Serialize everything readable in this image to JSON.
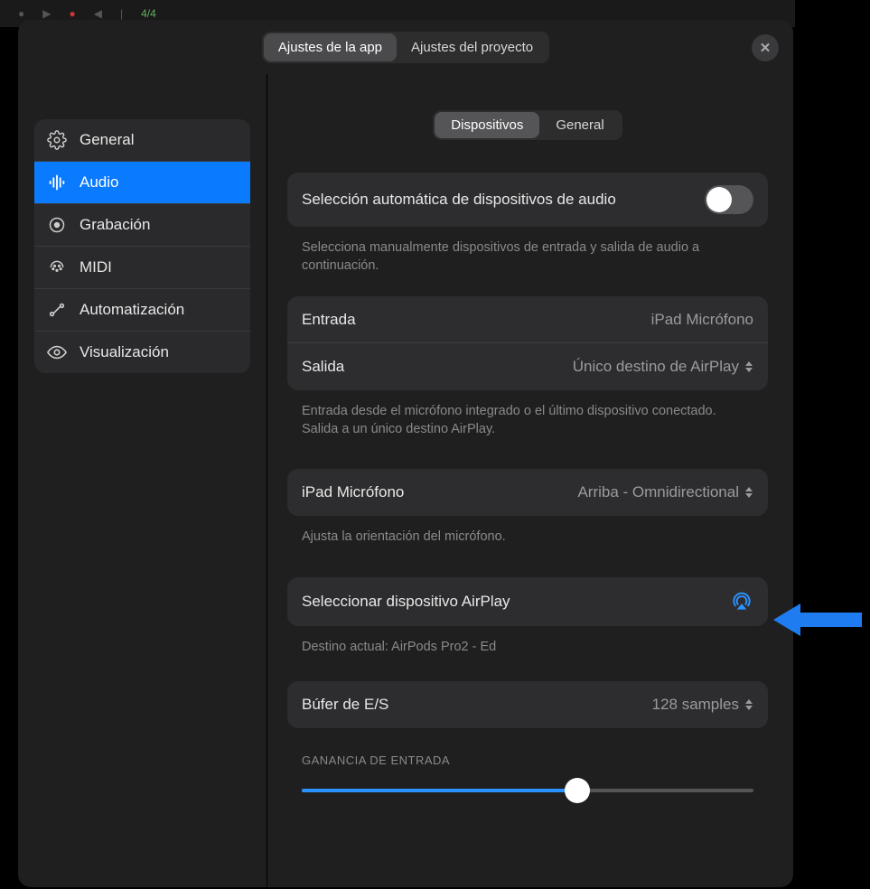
{
  "bg_hint": "4/4",
  "tabs": {
    "app": "Ajustes de la app",
    "project": "Ajustes del proyecto"
  },
  "sidebar": {
    "items": [
      {
        "label": "General"
      },
      {
        "label": "Audio"
      },
      {
        "label": "Grabación"
      },
      {
        "label": "MIDI"
      },
      {
        "label": "Automatización"
      },
      {
        "label": "Visualización"
      }
    ]
  },
  "subtabs": {
    "devices": "Dispositivos",
    "general": "General"
  },
  "auto_select": {
    "label": "Selección automática de dispositivos de audio",
    "helper": "Selecciona manualmente dispositivos de entrada y salida de audio a continuación."
  },
  "io": {
    "input_label": "Entrada",
    "input_value": "iPad Micrófono",
    "output_label": "Salida",
    "output_value": "Único destino de AirPlay",
    "helper": "Entrada desde el micrófono integrado o el último dispositivo conectado. Salida a un único destino AirPlay."
  },
  "mic": {
    "label": "iPad Micrófono",
    "value": "Arriba - Omnidirectional",
    "helper": "Ajusta la orientación del micrófono."
  },
  "airplay": {
    "label": "Seleccionar dispositivo AirPlay",
    "helper": "Destino actual: AirPods Pro2 - Ed"
  },
  "buffer": {
    "label": "Búfer de E/S",
    "value": "128 samples"
  },
  "gain": {
    "label": "GANANCIA DE ENTRADA",
    "percent": 61
  }
}
